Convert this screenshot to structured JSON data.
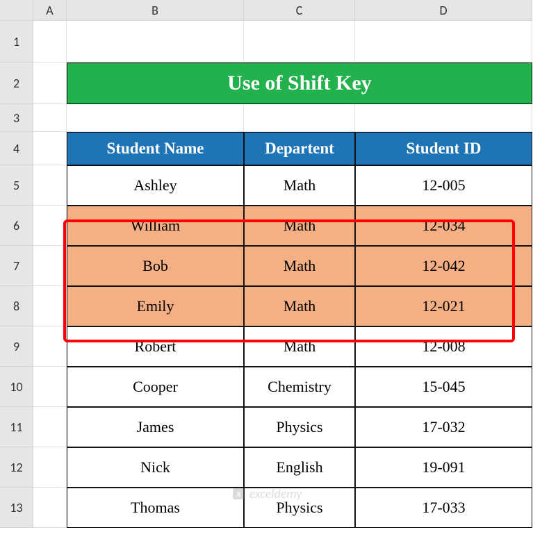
{
  "columns": [
    "A",
    "B",
    "C",
    "D"
  ],
  "rows": [
    "1",
    "2",
    "3",
    "4",
    "5",
    "6",
    "7",
    "8",
    "9",
    "10",
    "11",
    "12",
    "13"
  ],
  "title": "Use of Shift Key",
  "table": {
    "headers": [
      "Student Name",
      "Departent",
      "Student ID"
    ],
    "data": [
      {
        "name": "Ashley",
        "dept": "Math",
        "id": "12-005",
        "hl": false
      },
      {
        "name": "William",
        "dept": "Math",
        "id": "12-034",
        "hl": true
      },
      {
        "name": "Bob",
        "dept": "Math",
        "id": "12-042",
        "hl": true
      },
      {
        "name": "Emily",
        "dept": "Math",
        "id": "12-021",
        "hl": true
      },
      {
        "name": "Robert",
        "dept": "Math",
        "id": "12-008",
        "hl": false
      },
      {
        "name": "Cooper",
        "dept": "Chemistry",
        "id": "15-045",
        "hl": false
      },
      {
        "name": "James",
        "dept": "Physics",
        "id": "17-032",
        "hl": false
      },
      {
        "name": "Nick",
        "dept": "English",
        "id": "19-091",
        "hl": false
      },
      {
        "name": "Thomas",
        "dept": "Physics",
        "id": "17-033",
        "hl": false
      }
    ]
  },
  "watermark": "exceldemy"
}
